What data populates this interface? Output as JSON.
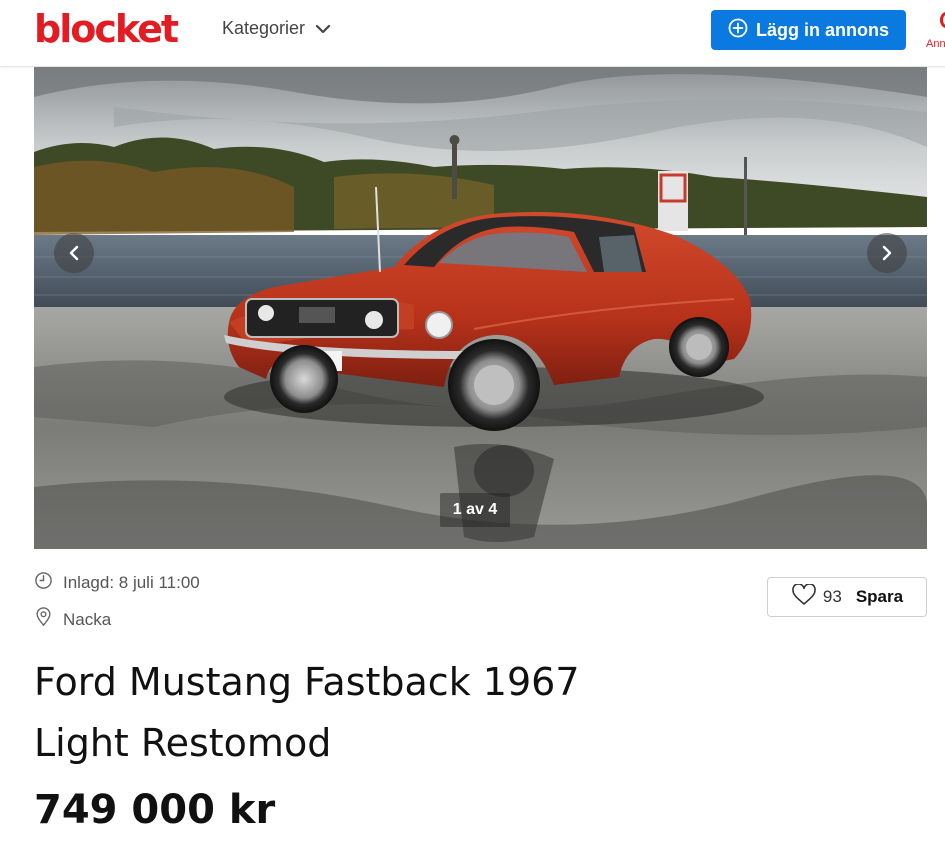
{
  "header": {
    "logo_text": "blocket",
    "categories_label": "Kategorier",
    "post_button_label": "Lägg in annons",
    "ads_link_fragment": "Ann"
  },
  "gallery": {
    "counter": "1 av 4"
  },
  "listing": {
    "posted": "Inlagd: 8 juli 11:00",
    "location": "Nacka",
    "save_count": "93",
    "save_label": "Spara",
    "title": "Ford Mustang Fastback 1967 Light Restomod",
    "price": "749 000 kr"
  },
  "colors": {
    "brand_red": "#e31b23",
    "primary_blue": "#0a7ae0"
  },
  "icons": [
    "chevron-down-icon",
    "plus-circle-icon",
    "chevron-left-icon",
    "chevron-right-icon",
    "clock-icon",
    "location-pin-icon",
    "heart-icon"
  ]
}
